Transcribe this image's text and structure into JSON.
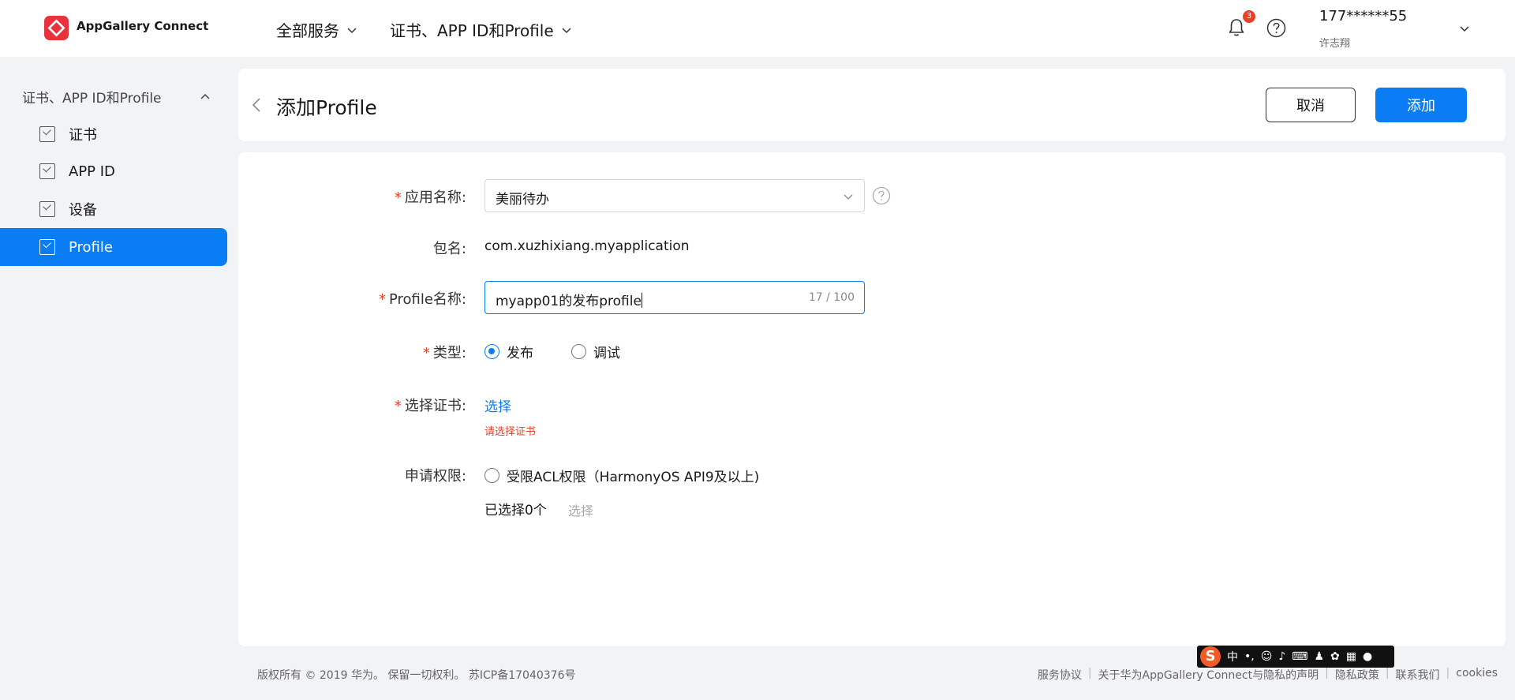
{
  "header": {
    "brand": "AppGallery Connect",
    "nav_all_services": "全部服务",
    "nav_current": "证书、APP ID和Profile",
    "notification_count": "3",
    "user_phone": "177******55",
    "user_name": "许志翔"
  },
  "sidebar": {
    "group_label": "证书、APP ID和Profile",
    "items": [
      {
        "label": "证书",
        "active": false
      },
      {
        "label": "APP ID",
        "active": false
      },
      {
        "label": "设备",
        "active": false
      },
      {
        "label": "Profile",
        "active": true
      }
    ]
  },
  "page": {
    "title": "添加Profile",
    "cancel_label": "取消",
    "add_label": "添加"
  },
  "form": {
    "app_name_label": "应用名称:",
    "app_name_value": "美丽待办",
    "package_label": "包名:",
    "package_value": "com.xuzhixiang.myapplication",
    "profile_name_label": "Profile名称:",
    "profile_name_value": "myapp01的发布profile",
    "profile_name_counter": "17 / 100",
    "type_label": "类型:",
    "type_options": [
      "发布",
      "调试"
    ],
    "type_selected": "发布",
    "cert_label": "选择证书:",
    "cert_link": "选择",
    "cert_error": "请选择证书",
    "permission_label": "申请权限:",
    "permission_option": "受限ACL权限（HarmonyOS API9及以上)",
    "selected_count": "已选择0个",
    "select_link": "选择"
  },
  "footer": {
    "copyright": "版权所有 © 2019 华为。 保留一切权利。 苏ICP备17040376号",
    "links": [
      "服务协议",
      "关于华为AppGallery Connect与隐私的声明",
      "隐私政策",
      "联系我们",
      "cookies"
    ]
  },
  "ime": {
    "logo": "S",
    "mode": "中",
    "punct": "•,"
  },
  "colors": {
    "accent": "#0a7df5",
    "brand_red": "#e8323c",
    "error": "#e84026"
  }
}
